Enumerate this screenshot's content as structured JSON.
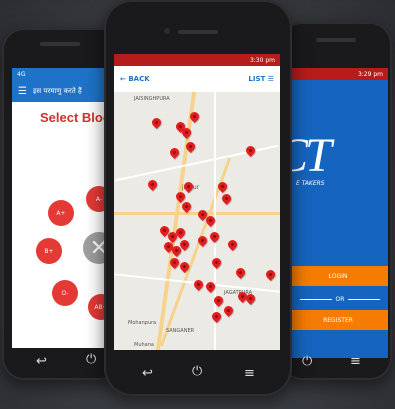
{
  "left_screen": {
    "status_text": "4G",
    "header_title": "इस परमाणु करते हैं",
    "heading": "Select Blood",
    "blood_groups": [
      "A+",
      "A-",
      "B+",
      "O-",
      "AB+"
    ]
  },
  "center_screen": {
    "status_time": "3:30 pm",
    "back_label": "BACK",
    "list_label": "LIST",
    "map_labels": {
      "city": "jaipur",
      "jagatpura": "JAGATPURA",
      "mohanpura": "Mohanpura",
      "muhana": "Muhana",
      "jaisinghpura": "JAISINGHPURA",
      "sanganer": "SANGANER"
    }
  },
  "right_screen": {
    "status_time": "3:29 pm",
    "logo_text": "CT",
    "tagline": "E TAKERS",
    "login_label": "LOGIN",
    "or_label": "OR",
    "register_label": "REGISTER"
  },
  "colors": {
    "header_blue": "#1e73c8",
    "pin_red": "#e21d1d",
    "orange": "#f57c00"
  }
}
